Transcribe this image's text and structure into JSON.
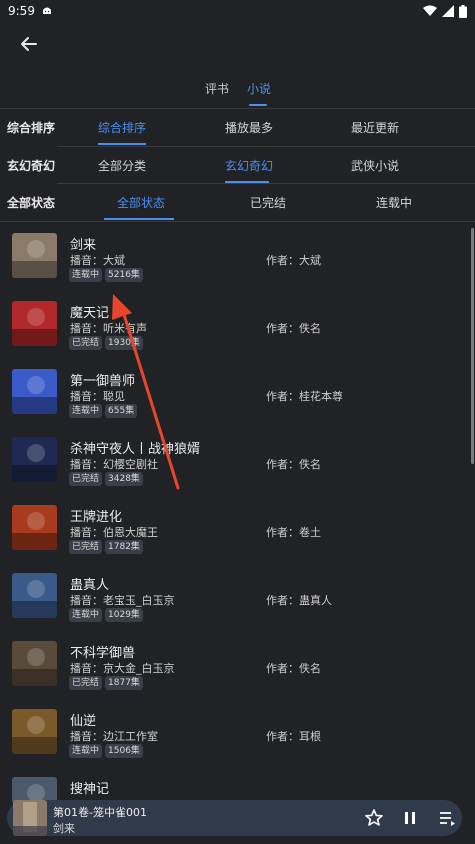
{
  "status": {
    "time": "9:59"
  },
  "top_tabs": [
    {
      "label": "评书",
      "active": false
    },
    {
      "label": "小说",
      "active": true
    }
  ],
  "filters": {
    "sort": {
      "label": "综合排序",
      "options": [
        "综合排序",
        "播放最多",
        "最近更新"
      ],
      "selected": 0
    },
    "category": {
      "label": "玄幻奇幻",
      "options": [
        "全部分类",
        "玄幻奇幻",
        "武侠小说"
      ],
      "selected": 1
    },
    "state": {
      "label": "全部状态",
      "options": [
        "全部状态",
        "已完结",
        "连载中"
      ],
      "selected": 0
    }
  },
  "items": [
    {
      "title": "剑来",
      "narrator": "播音：大斌",
      "author": "作者：大斌",
      "status": "连载中",
      "count": "5216集",
      "cover_color": "#8b7a6a"
    },
    {
      "title": "魔天记",
      "narrator": "播音：听米有声",
      "author": "作者：佚名",
      "status": "已完结",
      "count": "1930集",
      "cover_color": "#b02828"
    },
    {
      "title": "第一御兽师",
      "narrator": "播音：聪见",
      "author": "作者：桂花本尊",
      "status": "连载中",
      "count": "655集",
      "cover_color": "#3a5ac8"
    },
    {
      "title": "杀神守夜人丨战神狼婿",
      "narrator": "播音：幻樱空剧社",
      "author": "作者：佚名",
      "status": "已完结",
      "count": "3428集",
      "cover_color": "#1e2a52"
    },
    {
      "title": "王牌进化",
      "narrator": "播音：伯恩大魔王",
      "author": "作者：卷土",
      "status": "已完结",
      "count": "1782集",
      "cover_color": "#a83a1e"
    },
    {
      "title": "蛊真人",
      "narrator": "播音：老宝玉_白玉京",
      "author": "作者：蛊真人",
      "status": "连载中",
      "count": "1029集",
      "cover_color": "#3a5a8a"
    },
    {
      "title": "不科学御兽",
      "narrator": "播音：京大金_白玉京",
      "author": "作者：佚名",
      "status": "已完结",
      "count": "1877集",
      "cover_color": "#5a4a3a"
    },
    {
      "title": "仙逆",
      "narrator": "播音：边江工作室",
      "author": "作者：耳根",
      "status": "连载中",
      "count": "1506集",
      "cover_color": "#7a5a2a"
    },
    {
      "title": "搜神记",
      "narrator": "",
      "author": "",
      "status": "",
      "count": "",
      "cover_color": "#4a5a6a"
    }
  ],
  "player": {
    "track": "第01卷-笼中雀001",
    "book": "剑来"
  },
  "colors": {
    "accent": "#4c8ef0",
    "background": "#212225",
    "player_bg": "#2f3a4a",
    "arrow": "#e8452c"
  }
}
